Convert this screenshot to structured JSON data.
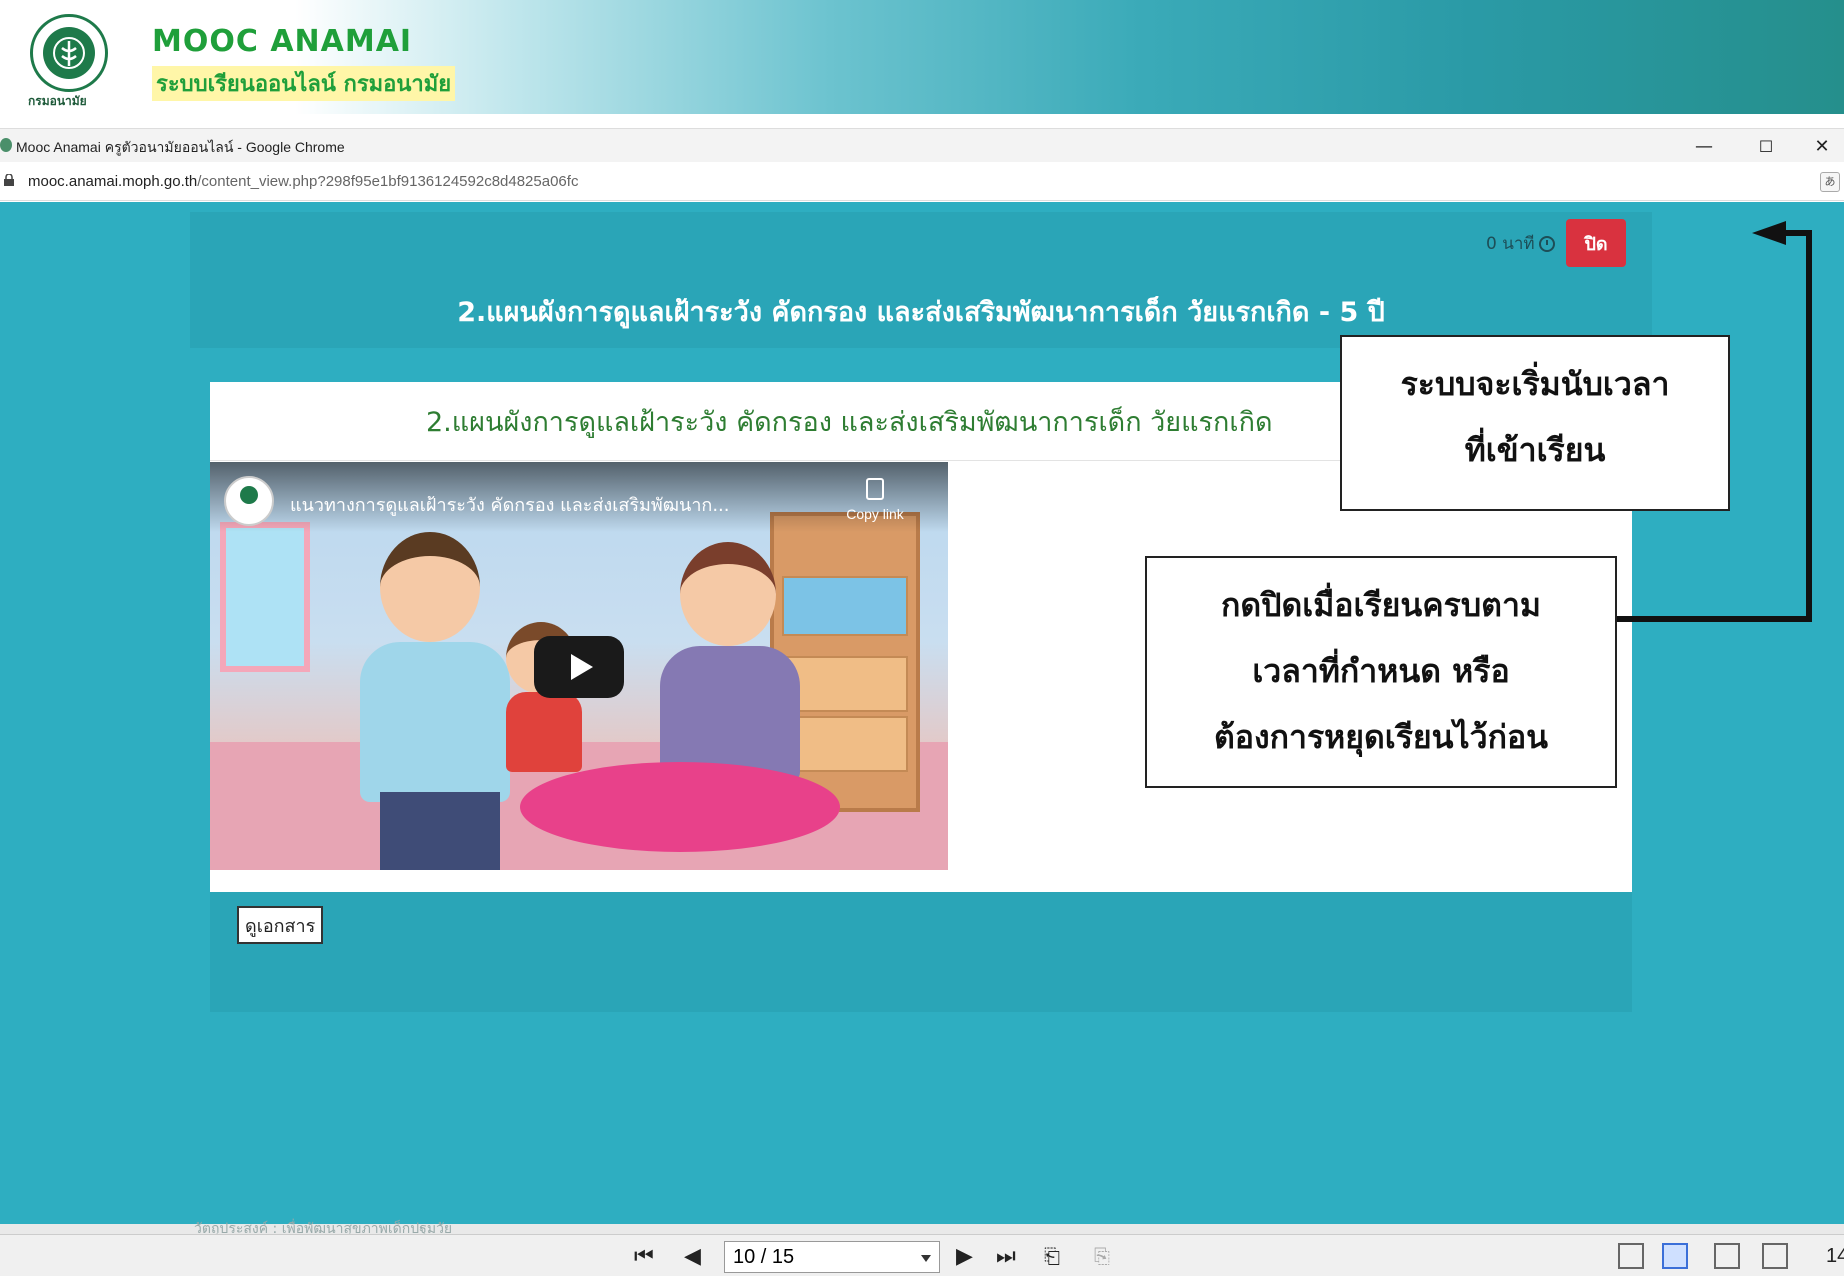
{
  "banner": {
    "title": "MOOC ANAMAI",
    "subtitle": "ระบบเรียนออนไลน์ กรมอนามัย",
    "logo_caption": "กรมอนามัย"
  },
  "window": {
    "title": "Mooc Anamai ครูตัวอนามัยออนไลน์ - Google Chrome",
    "minimize": "—",
    "maximize": "☐",
    "close": "✕"
  },
  "urlbar": {
    "host": "mooc.anamai.moph.go.th",
    "path": "/content_view.php?298f95e1bf9136124592c8d4825a06fc"
  },
  "content": {
    "timer_text": "0 นาที",
    "close_label": "ปิด",
    "page_heading": "2.แผนผังการดูแลเฝ้าระวัง คัดกรอง และส่งเสริมพัฒนาการเด็ก วัยแรกเกิด - 5 ปี",
    "card_title": "2.แผนผังการดูแลเฝ้าระวัง คัดกรอง และส่งเสริมพัฒนาการเด็ก วัยแรกเกิด",
    "video_title": "แนวทางการดูแลเฝ้าระวัง คัดกรอง และส่งเสริมพัฒนาก...",
    "copy_link": "Copy link",
    "doc_button": "ดูเอกสาร"
  },
  "callouts": {
    "timer_note_line1": "ระบบจะเริ่มนับเวลา",
    "timer_note_line2": "ที่เข้าเรียน",
    "close_note_line1": "กดปิดเมื่อเรียนครบตาม",
    "close_note_line2": "เวลาที่กำหนด หรือ",
    "close_note_line3": "ต้องการหยุดเรียนไว้ก่อน"
  },
  "pdf_toolbar": {
    "faded_text": "วัตถุประสงค์ : เพื่อพัฒนาสุขภาพเด็กปฐมวัย",
    "page_value": "10 / 15",
    "zoom": "14"
  }
}
